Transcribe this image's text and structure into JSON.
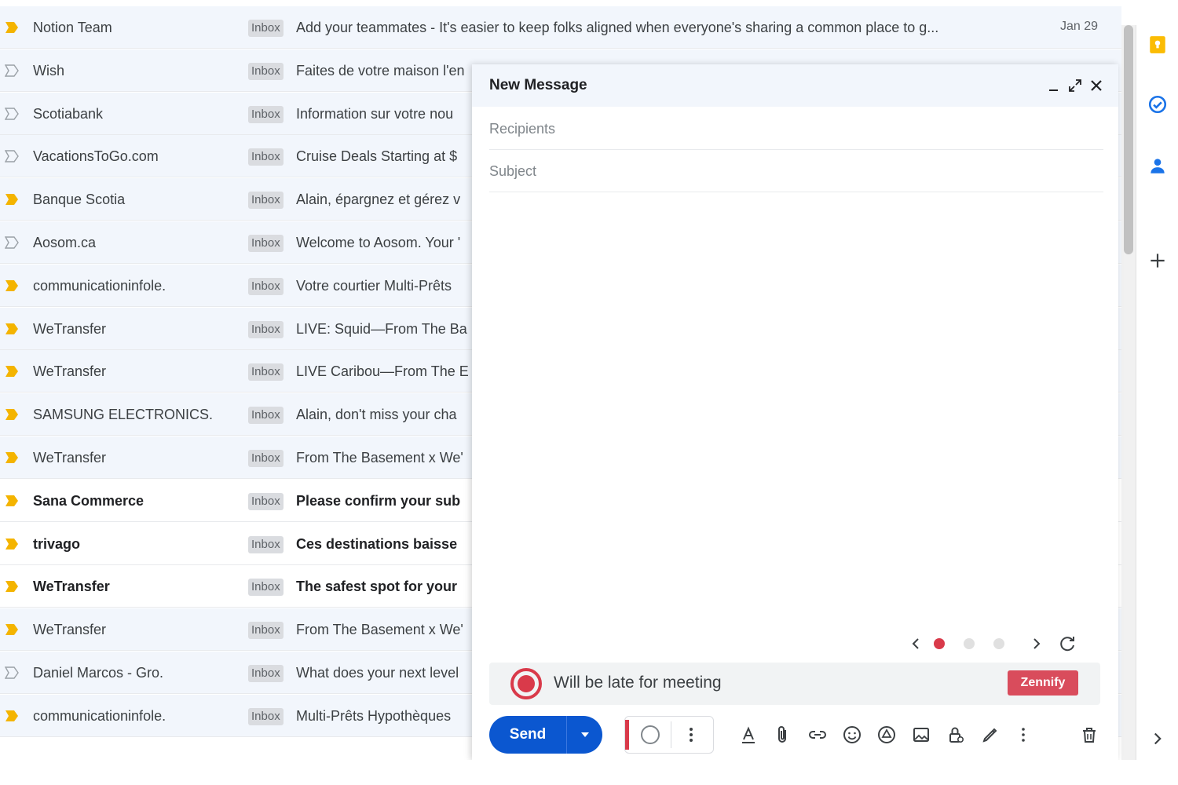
{
  "emails": [
    {
      "sender": "Notion Team",
      "label": "Inbox",
      "subject": "Add your teammates - It's easier to keep folks aligned when everyone's sharing a common place to g...",
      "date": "Jan 29",
      "important": true,
      "unread": false
    },
    {
      "sender": "Wish",
      "label": "Inbox",
      "subject": "Faites de votre maison l'en",
      "date": "",
      "important": false,
      "unread": false
    },
    {
      "sender": "Scotiabank",
      "label": "Inbox",
      "subject": "Information sur votre nou",
      "date": "",
      "important": false,
      "unread": false
    },
    {
      "sender": "VacationsToGo.com",
      "label": "Inbox",
      "subject": "Cruise Deals Starting at $",
      "date": "",
      "important": false,
      "unread": false
    },
    {
      "sender": "Banque Scotia",
      "label": "Inbox",
      "subject": "Alain, épargnez et gérez v",
      "date": "",
      "important": true,
      "unread": false
    },
    {
      "sender": "Aosom.ca",
      "label": "Inbox",
      "subject": "Welcome to Aosom. Your '",
      "date": "",
      "important": false,
      "unread": false
    },
    {
      "sender": "communicationinfole.",
      "label": "Inbox",
      "subject": "Votre courtier Multi-Prêts",
      "date": "",
      "important": true,
      "unread": false
    },
    {
      "sender": "WeTransfer",
      "label": "Inbox",
      "subject": "LIVE: Squid—From The Ba",
      "date": "",
      "important": true,
      "unread": false
    },
    {
      "sender": "WeTransfer",
      "label": "Inbox",
      "subject": "LIVE Caribou—From The E",
      "date": "",
      "important": true,
      "unread": false
    },
    {
      "sender": "SAMSUNG ELECTRONICS.",
      "label": "Inbox",
      "subject": "Alain, don't miss your cha",
      "date": "",
      "important": true,
      "unread": false
    },
    {
      "sender": "WeTransfer",
      "label": "Inbox",
      "subject": "From The Basement x We'",
      "date": "",
      "important": true,
      "unread": false
    },
    {
      "sender": "Sana Commerce",
      "label": "Inbox",
      "subject": "Please confirm your sub",
      "date": "",
      "important": true,
      "unread": true
    },
    {
      "sender": "trivago",
      "label": "Inbox",
      "subject": "Ces destinations baisse",
      "date": "",
      "important": true,
      "unread": true
    },
    {
      "sender": "WeTransfer",
      "label": "Inbox",
      "subject": "The safest spot for your",
      "date": "",
      "important": true,
      "unread": true
    },
    {
      "sender": "WeTransfer",
      "label": "Inbox",
      "subject": "From The Basement x We'",
      "date": "",
      "important": true,
      "unread": false
    },
    {
      "sender": "Daniel Marcos - Gro.",
      "label": "Inbox",
      "subject": "What does your next level",
      "date": "",
      "important": false,
      "unread": false
    },
    {
      "sender": "communicationinfole.",
      "label": "Inbox",
      "subject": "Multi-Prêts Hypothèques",
      "date": "",
      "important": true,
      "unread": false
    }
  ],
  "compose": {
    "title": "New Message",
    "recipients_placeholder": "Recipients",
    "subject_placeholder": "Subject",
    "zen_text": "Will be late for meeting",
    "zen_button": "Zennify",
    "send_label": "Send",
    "carousel_active_index": 0,
    "carousel_total": 3
  },
  "colors": {
    "important": "#f4b400",
    "send": "#0b57d0",
    "zennify": "#d94c5c",
    "record": "#d93a4a"
  },
  "icons": {
    "header": [
      "minimize-icon",
      "expand-icon",
      "close-icon"
    ],
    "toolbar": [
      "format-text-icon",
      "attach-icon",
      "link-icon",
      "emoji-icon",
      "drive-icon",
      "photo-icon",
      "confidential-icon",
      "signature-icon",
      "more-options-icon",
      "delete-icon"
    ],
    "side": [
      "keep-icon",
      "tasks-icon",
      "contacts-icon",
      "add-icon",
      "expand-panel-icon"
    ]
  }
}
